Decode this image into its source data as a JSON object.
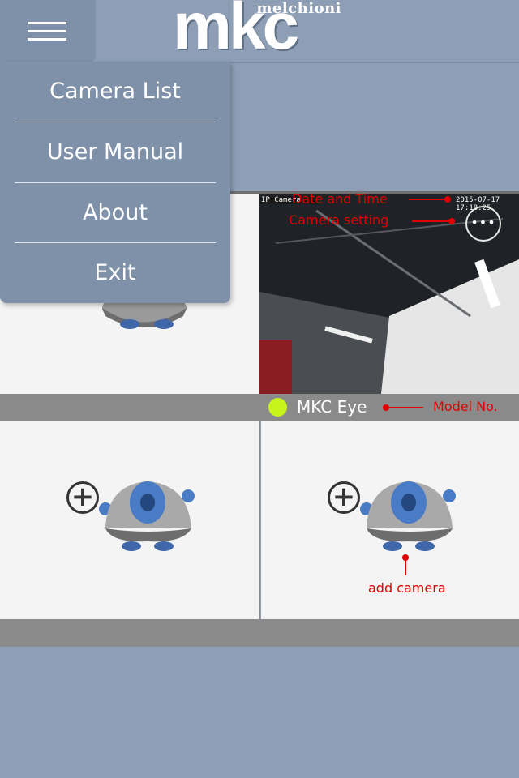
{
  "header": {
    "logo_small": "melchioni",
    "logo_big": "mkc"
  },
  "menu": {
    "icon": "hamburger-icon",
    "items": [
      {
        "label": "Camera List"
      },
      {
        "label": "User Manual"
      },
      {
        "label": "About"
      },
      {
        "label": "Exit"
      }
    ]
  },
  "camera_feed": {
    "overlay_left": "IP Camera",
    "timestamp": "2015-07-17 17:18:25",
    "settings_icon": "more-dots-icon",
    "name": "MKC Eye",
    "status_color": "#c6f41c"
  },
  "annotations": {
    "date_time": "Date and Time",
    "camera_setting": "Camera setting",
    "model_no": "Model No.",
    "add_camera": "add camera"
  },
  "colors": {
    "background": "#8e9fb5",
    "menu": "#7e91a8",
    "annotation": "#e10000",
    "strip": "#8a8a8a"
  }
}
